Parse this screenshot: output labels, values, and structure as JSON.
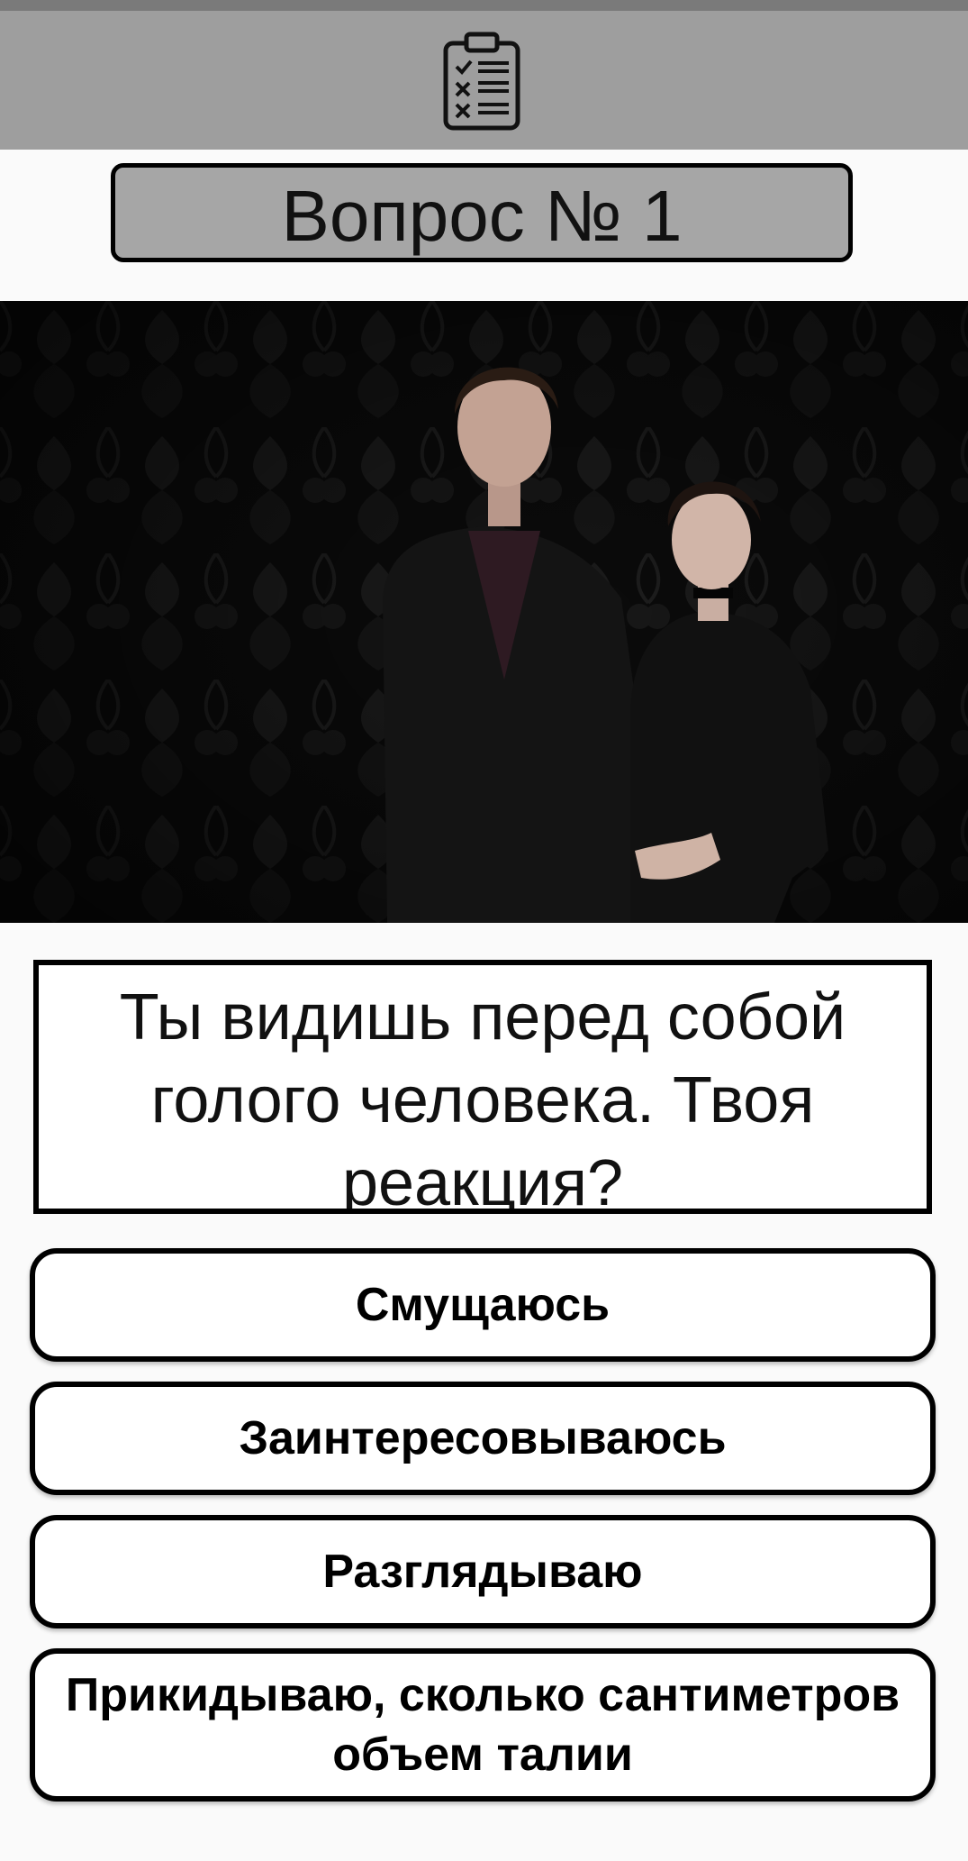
{
  "header": {
    "icon": "clipboard-checklist-icon",
    "background_color": "#9e9e9e"
  },
  "question": {
    "number_label": "Вопрос № 1",
    "image_icon": "photo-two-people-dark-background",
    "text": "Ты видишь перед собой голого человека. Твоя реакция?"
  },
  "answers": [
    {
      "label": "Смущаюсь"
    },
    {
      "label": "Заинтересовываюсь"
    },
    {
      "label": "Разглядываю"
    },
    {
      "label": "Прикидываю, сколько сантиметров объем талии"
    }
  ]
}
